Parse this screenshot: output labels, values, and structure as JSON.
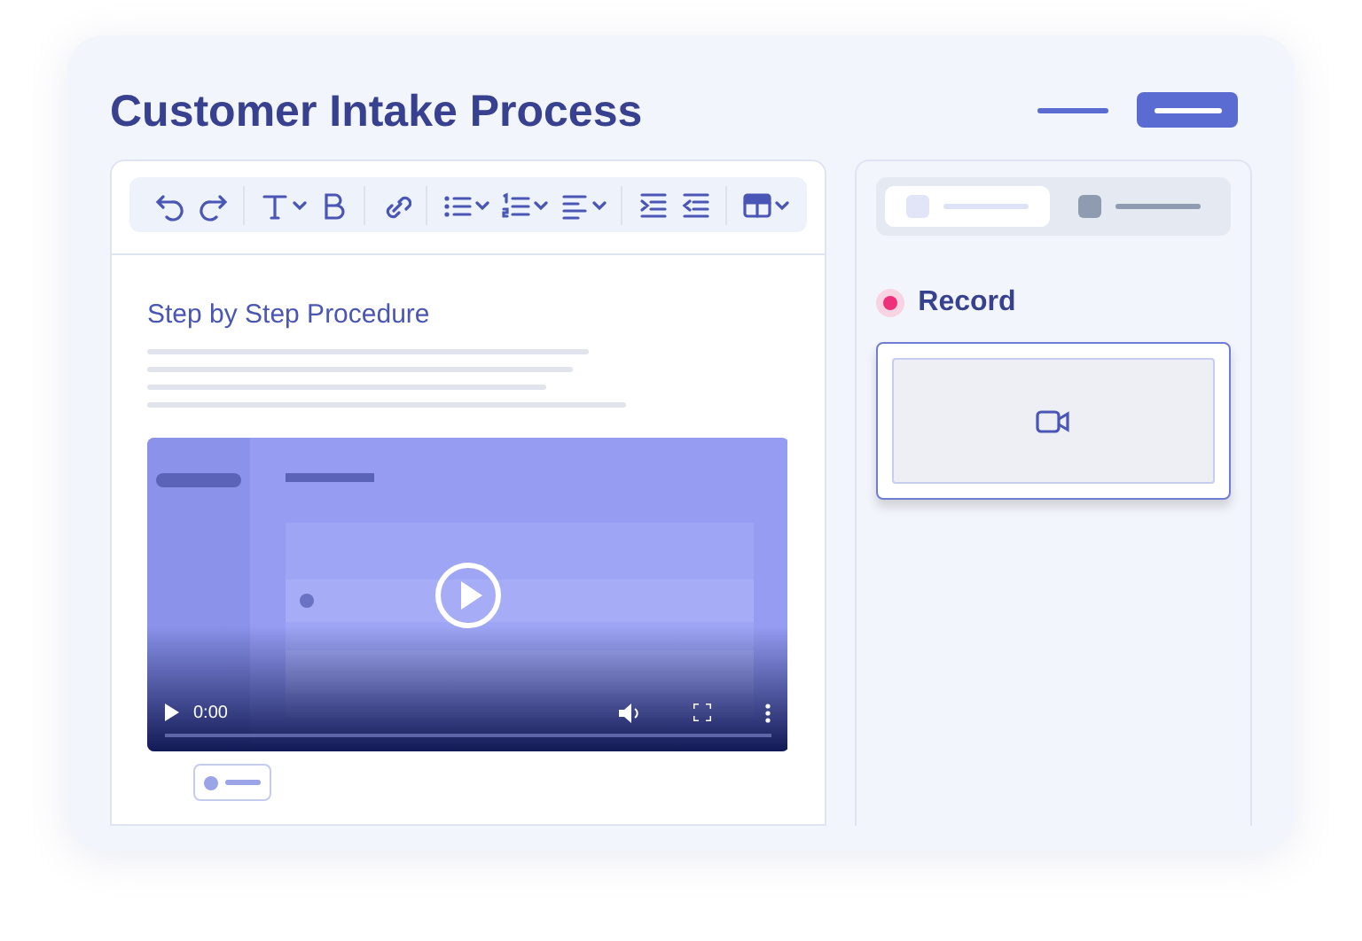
{
  "title": "Customer Intake Process",
  "header_actions": [
    {
      "kind": "link"
    },
    {
      "kind": "button"
    }
  ],
  "toolbar": [
    [
      {
        "kind": "undo",
        "dropdown": false
      },
      {
        "kind": "redo",
        "dropdown": false
      }
    ],
    [
      {
        "kind": "text",
        "dropdown": true
      },
      {
        "kind": "bold",
        "dropdown": false
      }
    ],
    [
      {
        "kind": "link",
        "dropdown": false
      }
    ],
    [
      {
        "kind": "bullets",
        "dropdown": true
      },
      {
        "kind": "numbers",
        "dropdown": true
      },
      {
        "kind": "align",
        "dropdown": true
      }
    ],
    [
      {
        "kind": "indent",
        "dropdown": false
      },
      {
        "kind": "outdent",
        "dropdown": false
      }
    ],
    [
      {
        "kind": "table",
        "dropdown": true
      }
    ]
  ],
  "document": {
    "heading": "Step by Step Procedure"
  },
  "video": {
    "kind": "picture",
    "time": "0:00"
  },
  "tabs": [
    {
      "selected": true
    },
    {
      "selected": false
    }
  ],
  "record": {
    "label": "Record",
    "active": true
  }
}
